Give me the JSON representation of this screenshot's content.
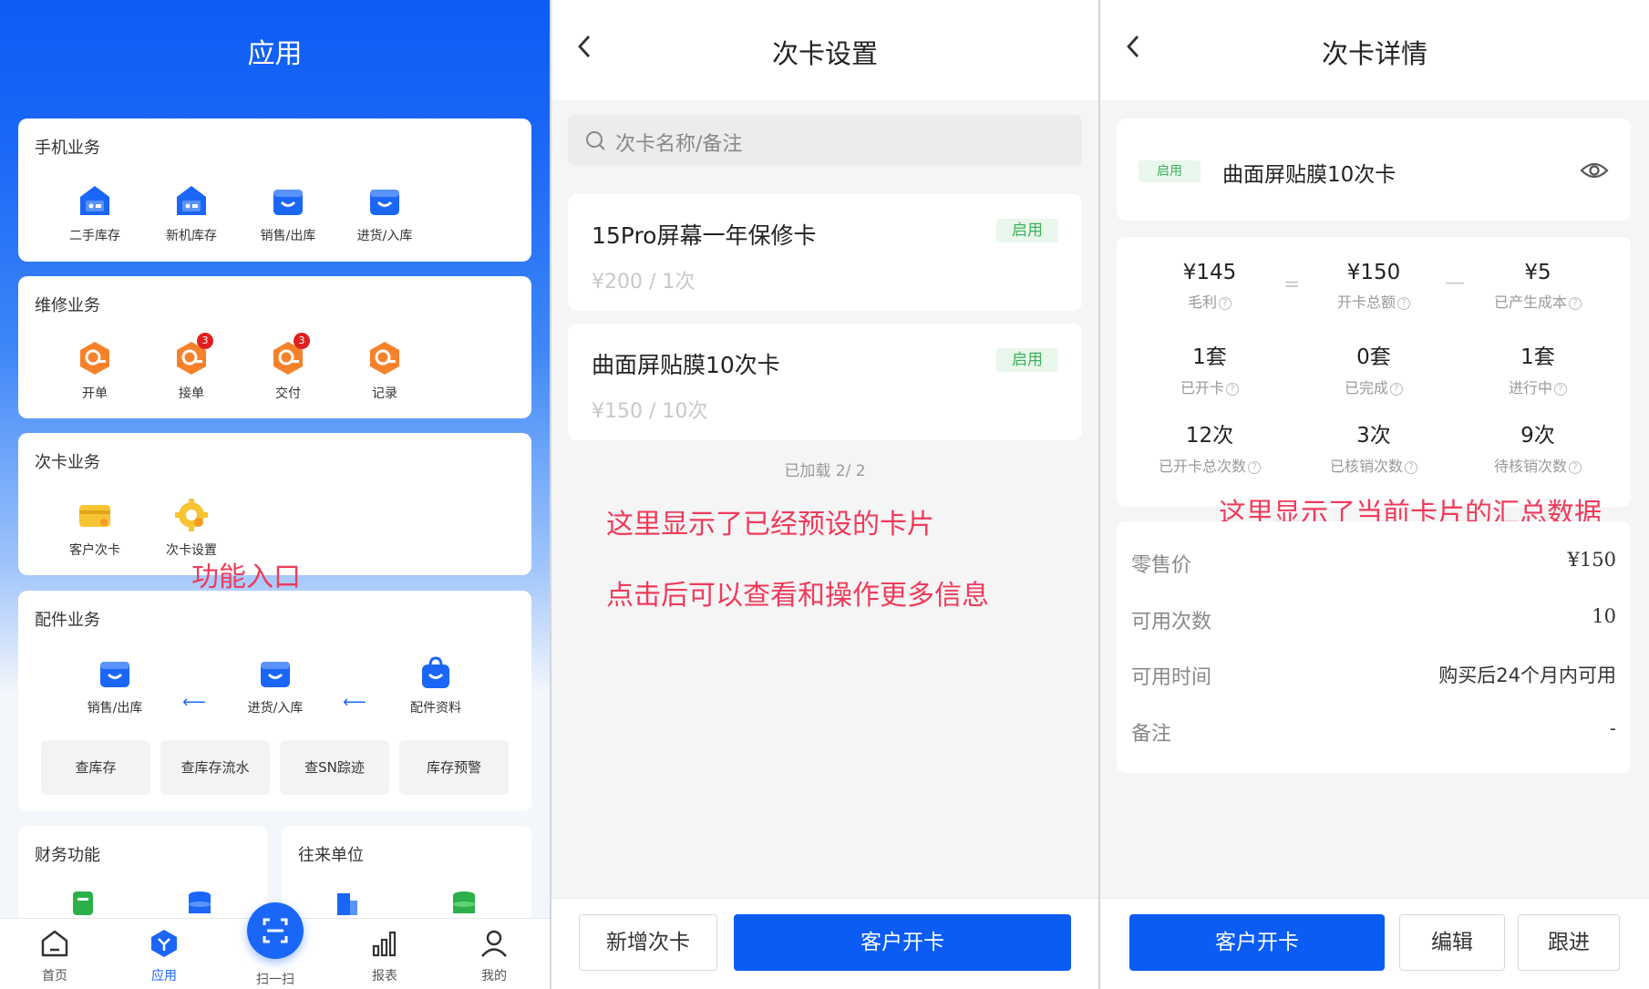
{
  "panel1": {
    "title": "应用",
    "phone_section": {
      "title": "手机业务",
      "items": [
        "二手库存",
        "新机库存",
        "销售/出库",
        "进货/入库"
      ]
    },
    "repair_section": {
      "title": "维修业务",
      "items": [
        "开单",
        "接单",
        "交付",
        "记录"
      ],
      "badges": {
        "receive": "3",
        "deliver": "3"
      }
    },
    "card_section": {
      "title": "次卡业务",
      "items": [
        "客户次卡",
        "次卡设置"
      ]
    },
    "parts_section": {
      "title": "配件业务",
      "items": [
        "销售/出库",
        "进货/入库",
        "配件资料"
      ],
      "buttons": [
        "查库存",
        "查库存流水",
        "查SN踪迹",
        "库存预警"
      ]
    },
    "finance_section": {
      "title": "财务功能"
    },
    "partner_section": {
      "title": "往来单位"
    },
    "annotation": "功能入口",
    "tabbar": [
      "首页",
      "应用",
      "扫一扫",
      "报表",
      "我的"
    ]
  },
  "panel2": {
    "title": "次卡设置",
    "search_placeholder": "次卡名称/备注",
    "cards": [
      {
        "name": "15Pro屏幕一年保修卡",
        "price": "¥200 / 1次",
        "status": "启用"
      },
      {
        "name": "曲面屏贴膜10次卡",
        "price": "¥150 / 10次",
        "status": "启用"
      }
    ],
    "loaded": "已加载 2/ 2",
    "annotation1": "这里显示了已经预设的卡片",
    "annotation2": "点击后可以查看和操作更多信息",
    "btn_add": "新增次卡",
    "btn_open": "客户开卡"
  },
  "panel3": {
    "title": "次卡详情",
    "status": "启用",
    "card_name": "曲面屏贴膜10次卡",
    "stats": [
      {
        "value": "¥145",
        "label": "毛利"
      },
      {
        "value": "¥150",
        "label": "开卡总额"
      },
      {
        "value": "¥5",
        "label": "已产生成本"
      },
      {
        "value": "1套",
        "label": "已开卡"
      },
      {
        "value": "0套",
        "label": "已完成"
      },
      {
        "value": "1套",
        "label": "进行中"
      },
      {
        "value": "12次",
        "label": "已开卡总次数"
      },
      {
        "value": "3次",
        "label": "已核销次数"
      },
      {
        "value": "9次",
        "label": "待核销次数"
      }
    ],
    "op_equal": "=",
    "op_minus": "—",
    "annotation": "这里显示了当前卡片的汇总数据",
    "details": [
      {
        "key": "零售价",
        "value": "¥150"
      },
      {
        "key": "可用次数",
        "value": "10"
      },
      {
        "key": "可用时间",
        "value": "购买后24个月内可用"
      },
      {
        "key": "备注",
        "value": "-"
      }
    ],
    "btn_open": "客户开卡",
    "btn_edit": "编辑",
    "btn_follow": "跟进"
  }
}
